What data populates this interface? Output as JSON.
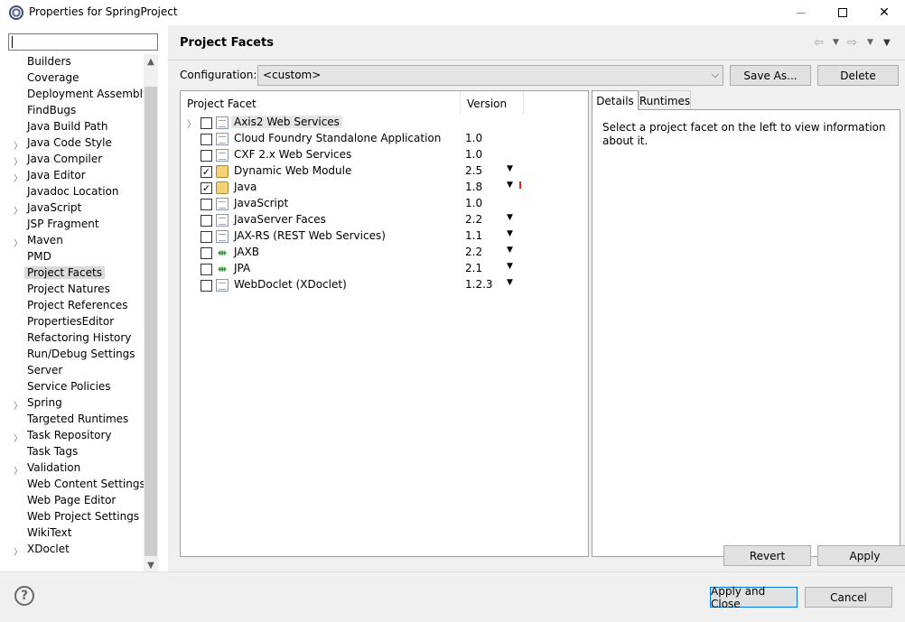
{
  "window": {
    "title": "Properties for SpringProject",
    "minimize": "",
    "close": "✕"
  },
  "sidebar": {
    "filter_value": "",
    "items": [
      {
        "label": "Builders",
        "expandable": false
      },
      {
        "label": "Coverage",
        "expandable": false
      },
      {
        "label": "Deployment Assembly",
        "expandable": false
      },
      {
        "label": "FindBugs",
        "expandable": false
      },
      {
        "label": "Java Build Path",
        "expandable": false
      },
      {
        "label": "Java Code Style",
        "expandable": true
      },
      {
        "label": "Java Compiler",
        "expandable": true
      },
      {
        "label": "Java Editor",
        "expandable": true
      },
      {
        "label": "Javadoc Location",
        "expandable": false
      },
      {
        "label": "JavaScript",
        "expandable": true
      },
      {
        "label": "JSP Fragment",
        "expandable": false
      },
      {
        "label": "Maven",
        "expandable": true
      },
      {
        "label": "PMD",
        "expandable": false
      },
      {
        "label": "Project Facets",
        "expandable": false,
        "selected": true
      },
      {
        "label": "Project Natures",
        "expandable": false
      },
      {
        "label": "Project References",
        "expandable": false
      },
      {
        "label": "PropertiesEditor",
        "expandable": false
      },
      {
        "label": "Refactoring History",
        "expandable": false
      },
      {
        "label": "Run/Debug Settings",
        "expandable": false
      },
      {
        "label": "Server",
        "expandable": false
      },
      {
        "label": "Service Policies",
        "expandable": false
      },
      {
        "label": "Spring",
        "expandable": true
      },
      {
        "label": "Targeted Runtimes",
        "expandable": false
      },
      {
        "label": "Task Repository",
        "expandable": true
      },
      {
        "label": "Task Tags",
        "expandable": false
      },
      {
        "label": "Validation",
        "expandable": true
      },
      {
        "label": "Web Content Settings",
        "expandable": false
      },
      {
        "label": "Web Page Editor",
        "expandable": false
      },
      {
        "label": "Web Project Settings",
        "expandable": false
      },
      {
        "label": "WikiText",
        "expandable": false
      },
      {
        "label": "XDoclet",
        "expandable": true
      }
    ]
  },
  "main": {
    "title": "Project Facets",
    "configuration_label": "Configuration:",
    "configuration_value": "<custom>",
    "save_as": "Save As...",
    "delete": "Delete",
    "columns": {
      "facet": "Project Facet",
      "version": "Version"
    },
    "facets": [
      {
        "name": "Axis2 Web Services",
        "version": "",
        "checked": false,
        "expandable": true,
        "icon": "doc-icon",
        "dropdown": false,
        "highlight": true
      },
      {
        "name": "Cloud Foundry Standalone Application",
        "version": "1.0",
        "checked": false,
        "expandable": false,
        "icon": "doc-icon",
        "dropdown": false
      },
      {
        "name": "CXF 2.x Web Services",
        "version": "1.0",
        "checked": false,
        "expandable": false,
        "icon": "doc-icon",
        "dropdown": false
      },
      {
        "name": "Dynamic Web Module",
        "version": "2.5",
        "checked": true,
        "expandable": false,
        "icon": "gear-doc-icon",
        "dropdown": true
      },
      {
        "name": "Java",
        "version": "1.8",
        "checked": true,
        "expandable": false,
        "icon": "gear-doc-icon",
        "dropdown": true,
        "error": true
      },
      {
        "name": "JavaScript",
        "version": "1.0",
        "checked": false,
        "expandable": false,
        "icon": "doc-icon",
        "dropdown": false
      },
      {
        "name": "JavaServer Faces",
        "version": "2.2",
        "checked": false,
        "expandable": false,
        "icon": "doc-icon",
        "dropdown": true
      },
      {
        "name": "JAX-RS (REST Web Services)",
        "version": "1.1",
        "checked": false,
        "expandable": false,
        "icon": "doc-icon",
        "dropdown": true
      },
      {
        "name": "JAXB",
        "version": "2.2",
        "checked": false,
        "expandable": false,
        "icon": "link-icon",
        "dropdown": true
      },
      {
        "name": "JPA",
        "version": "2.1",
        "checked": false,
        "expandable": false,
        "icon": "link-icon",
        "dropdown": true
      },
      {
        "name": "WebDoclet (XDoclet)",
        "version": "1.2.3",
        "checked": false,
        "expandable": false,
        "icon": "doc-icon",
        "dropdown": true
      }
    ],
    "tabs": {
      "details": "Details",
      "runtimes": "Runtimes"
    },
    "details_text": "Select a project facet on the left to view information about it.",
    "revert": "Revert",
    "apply": "Apply"
  },
  "footer": {
    "help": "?",
    "apply_and_close": "Apply and Close",
    "cancel": "Cancel"
  }
}
